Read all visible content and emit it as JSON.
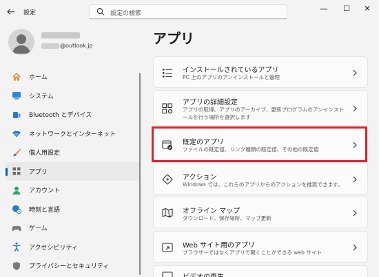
{
  "window": {
    "title": "設定",
    "controls": {
      "minimize": "—",
      "maximize": "☐",
      "close": "✕"
    }
  },
  "search": {
    "placeholder": "設定の検索"
  },
  "profile": {
    "email_domain": "@outlook.jp"
  },
  "sidebar": {
    "items": [
      {
        "label": "ホーム",
        "icon": "home-icon",
        "active": false
      },
      {
        "label": "システム",
        "icon": "system-icon",
        "active": false
      },
      {
        "label": "Bluetooth とデバイス",
        "icon": "bluetooth-icon",
        "active": false
      },
      {
        "label": "ネットワークとインターネット",
        "icon": "network-icon",
        "active": false
      },
      {
        "label": "個人用設定",
        "icon": "brush-icon",
        "active": false
      },
      {
        "label": "アプリ",
        "icon": "apps-icon",
        "active": true
      },
      {
        "label": "アカウント",
        "icon": "account-icon",
        "active": false
      },
      {
        "label": "時刻と言語",
        "icon": "globe-clock-icon",
        "active": false
      },
      {
        "label": "ゲーム",
        "icon": "gamepad-icon",
        "active": false
      },
      {
        "label": "アクセシビリティ",
        "icon": "accessibility-icon",
        "active": false
      },
      {
        "label": "プライバシーとセキュリティ",
        "icon": "shield-icon",
        "active": false
      }
    ]
  },
  "main": {
    "title": "アプリ",
    "cards": [
      {
        "title": "インストールされているアプリ",
        "desc": "PC 上のアプリのアンインストールと管理",
        "icon": "installed-apps-icon"
      },
      {
        "title": "アプリの詳細設定",
        "desc": "アプリの取得、アプリのアーカイブ、更新プログラムのアンインストールを行う場所を選択します",
        "icon": "advanced-apps-icon"
      },
      {
        "title": "既定のアプリ",
        "desc": "ファイルの既定値、リンク種類の既定値、その他の既定値",
        "icon": "default-apps-icon",
        "highlighted": true
      },
      {
        "title": "アクション",
        "desc": "Windows では、これらのアプリからのアクションを推奨できます。",
        "icon": "actions-icon"
      },
      {
        "title": "オフライン マップ",
        "desc": "ダウンロード、保存場所、マップ更新",
        "icon": "offline-maps-icon"
      },
      {
        "title": "Web サイト用のアプリ",
        "desc": "ブラウザーではなくアプリで開くことができる web サイト",
        "icon": "web-apps-icon"
      },
      {
        "title": "ビデオの再生",
        "desc": "",
        "icon": "video-playback-icon"
      }
    ]
  },
  "colors": {
    "accent": "#005fb8",
    "highlight": "#d9232e"
  }
}
